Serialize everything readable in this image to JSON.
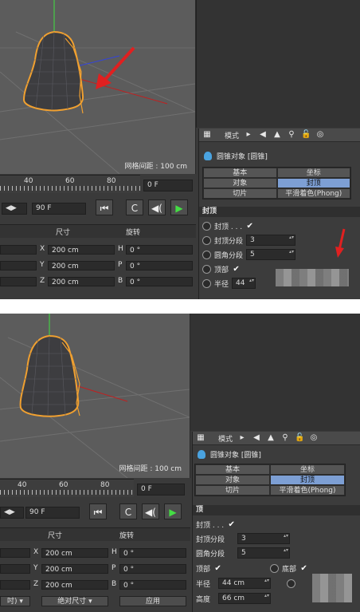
{
  "viewport": {
    "grid_spacing": "网格间距 : 100 cm"
  },
  "timeline": {
    "ticks": [
      "40",
      "60",
      "80"
    ],
    "current_frame": "0 F",
    "end_frame": "90 F"
  },
  "coords": {
    "headers": {
      "size": "尺寸",
      "rotation": "旋转"
    },
    "rows": [
      {
        "axis": "X",
        "size": "200 cm",
        "rot_axis": "H",
        "rot": "0 °"
      },
      {
        "axis": "Y",
        "size": "200 cm",
        "rot_axis": "P",
        "rot": "0 °"
      },
      {
        "axis": "Z",
        "size": "200 cm",
        "rot_axis": "B",
        "rot": "0 °"
      }
    ],
    "bottom": {
      "mode_suffix": "吋)",
      "size_mode": "绝对尺寸",
      "apply": "应用"
    }
  },
  "attributes": {
    "toolbar_label": "模式",
    "object_title": "圆锥对象 [圆锥]",
    "tabs": [
      "基本",
      "坐标",
      "对象",
      "封顶",
      "切片",
      "平滑着色(Phong)"
    ],
    "active_tab": "封顶",
    "section": "封顶",
    "section_short": "顶",
    "props": {
      "caps": "封顶 . . .",
      "cap_segments": "封顶分段",
      "cap_segments_val": "3",
      "fillet_segments": "圆角分段",
      "fillet_segments_val": "5",
      "top": "顶部",
      "bottom": "底部",
      "radius": "半径",
      "radius_val1": "44",
      "radius_val2": "44 cm",
      "height": "高度",
      "height_val": "66 cm"
    }
  },
  "colors": {
    "accent_tab": "#7d9fd4",
    "arrow": "#e02020"
  },
  "icons": [
    "grid-icon",
    "arrow-left-icon",
    "cursor-icon",
    "search-icon",
    "lock-icon",
    "target-icon",
    "cone-icon",
    "first-frame-icon",
    "record-icon",
    "key-icon",
    "play-icon"
  ]
}
